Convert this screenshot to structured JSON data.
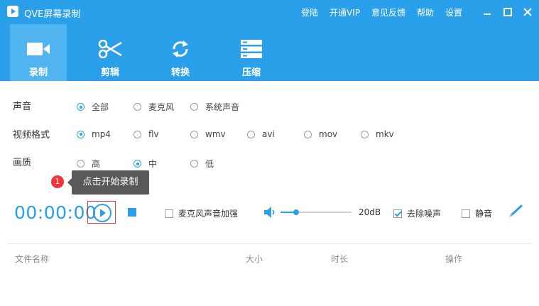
{
  "window": {
    "title": "QVE屏幕录制"
  },
  "top_menu": {
    "login": "登陆",
    "vip": "开通VIP",
    "feedback": "意见反馈",
    "help": "帮助",
    "settings": "设置"
  },
  "tabs": [
    {
      "label": "录制",
      "icon": "video-camera-icon",
      "active": true
    },
    {
      "label": "剪辑",
      "icon": "scissors-icon",
      "active": false
    },
    {
      "label": "转换",
      "icon": "sync-icon",
      "active": false
    },
    {
      "label": "压缩",
      "icon": "server-icon",
      "active": false
    }
  ],
  "options": {
    "sound": {
      "label": "声音",
      "choices": [
        "全部",
        "麦克风",
        "系统声音"
      ],
      "selected": "全部"
    },
    "format": {
      "label": "视频格式",
      "choices": [
        "mp4",
        "flv",
        "wmv",
        "avi",
        "mov",
        "mkv"
      ],
      "selected": "mp4"
    },
    "quality": {
      "label": "画质",
      "choices": [
        "高",
        "中",
        "低"
      ],
      "selected": "中"
    }
  },
  "tip": {
    "badge": "1",
    "text": "点击开始录制"
  },
  "controls": {
    "timer": "00:00:00",
    "mic_boost": "麦克风声音加强",
    "volume_percent": 22,
    "volume_db": "20dB",
    "denoise": "去除噪声",
    "denoise_checked": true,
    "mute": "静音",
    "mute_checked": false
  },
  "file_table": {
    "columns": [
      "文件名称",
      "大小",
      "时长",
      "操作"
    ]
  },
  "colors": {
    "primary": "#2aa0ea",
    "accent": "#2a9fe9",
    "tab_active": "#50b4f0",
    "badge": "#f0343a"
  }
}
